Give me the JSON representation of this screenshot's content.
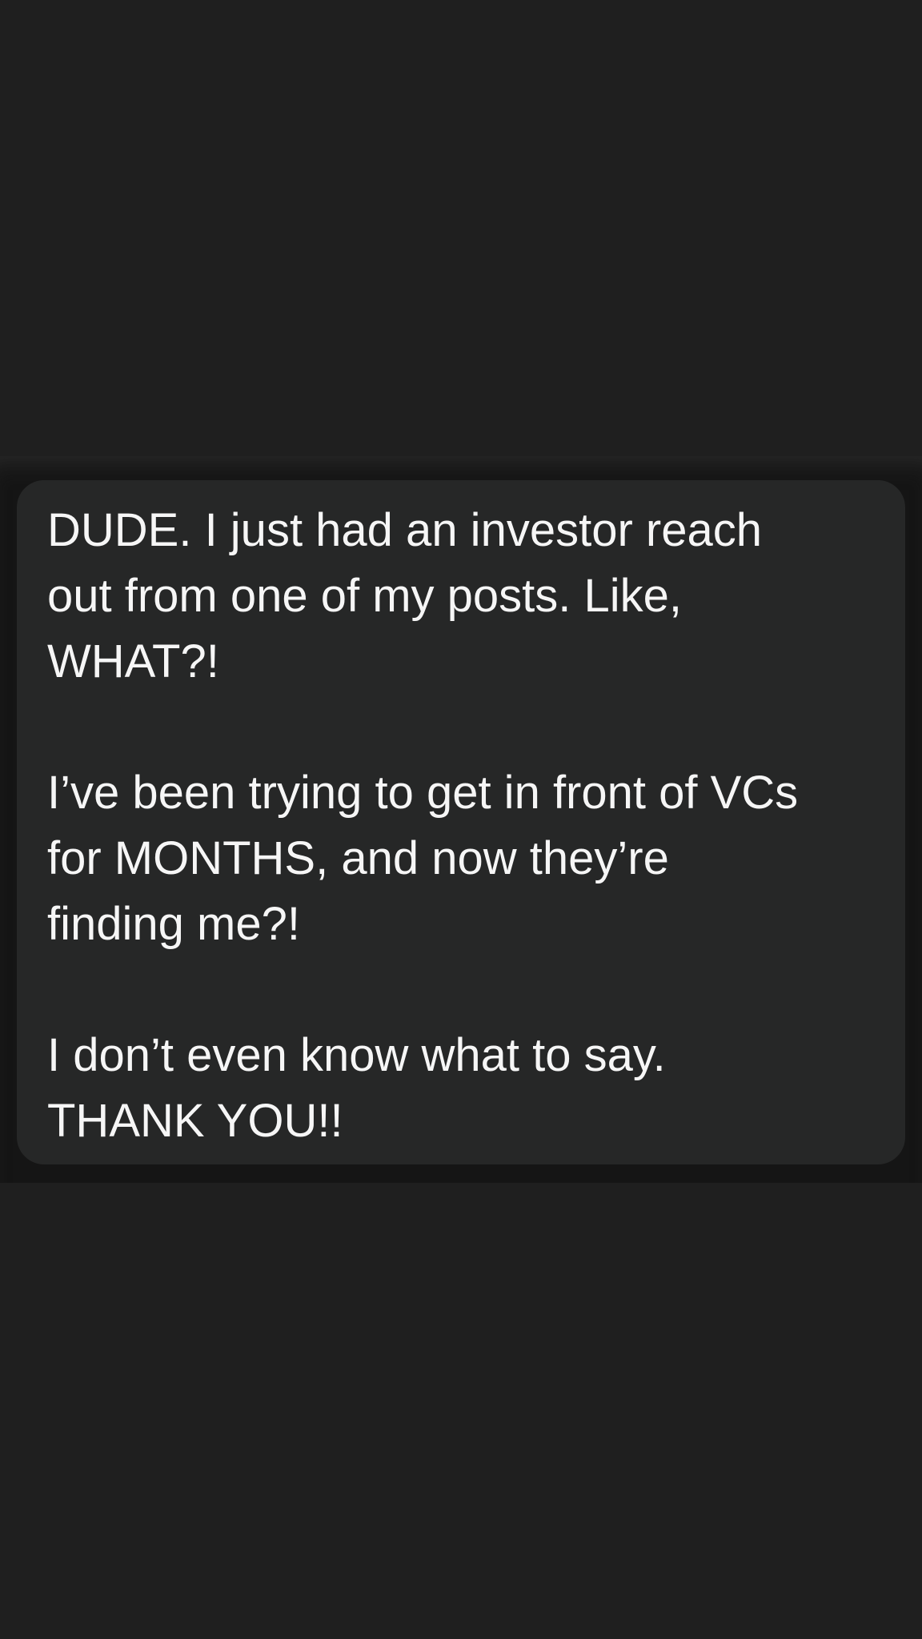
{
  "message": {
    "text": "DUDE. I just had an investor reach\nout from one of my posts. Like,\nWHAT?!\n\nI’ve been trying to get in front of VCs\nfor MONTHS, and now they’re\nfinding me?!\n\nI don’t even know what to say.\nTHANK YOU!!"
  },
  "colors": {
    "page_background": "#1f1f1f",
    "bubble_background": "#262727",
    "message_text": "#f6f6f6"
  }
}
